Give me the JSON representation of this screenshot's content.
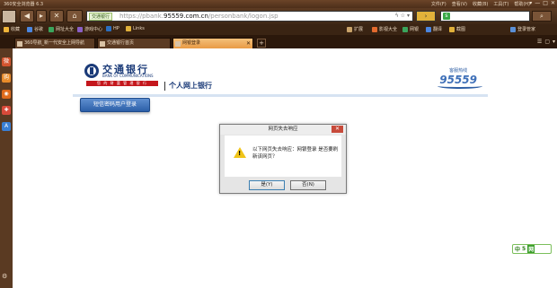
{
  "window": {
    "title": "360安全浏览器 6.3",
    "menus": [
      "文件(F)",
      "查看(V)",
      "收藏(B)",
      "工具(T)",
      "帮助(H)"
    ],
    "controls": [
      "▾",
      "—",
      "□",
      "✕"
    ]
  },
  "navbar": {
    "site_badge": "交通银行",
    "url_dim_prefix": "https://pbank.",
    "url_domain": "95559.com.cn",
    "url_dim_suffix": "/personbank/logon.jsp",
    "go_label": "›",
    "search_icon": "s",
    "search_button": "⌕"
  },
  "favorites": [
    {
      "label": "收藏",
      "color": "#f0b53a"
    },
    {
      "label": "谷歌",
      "color": "#4b86e0"
    },
    {
      "label": "网址大全",
      "color": "#3aa55c"
    },
    {
      "label": "游戏中心",
      "color": "#8a5fc5"
    },
    {
      "label": "HP",
      "color": "#2c6fbf"
    },
    {
      "label": "Links",
      "color": "#e0b03a"
    },
    {
      "label": "扩展",
      "color": "#c9a36a"
    },
    {
      "label": "影视大全",
      "color": "#e36a2e"
    },
    {
      "label": "网银",
      "color": "#3aa55c"
    },
    {
      "label": "翻译",
      "color": "#4b86e0"
    },
    {
      "label": "截图",
      "color": "#e0b03a"
    },
    {
      "label": "登录管家",
      "color": "#5a8fd6"
    }
  ],
  "tabs": [
    {
      "label": "360导航_新一代安全上网导航",
      "active": false
    },
    {
      "label": "交通银行首页",
      "active": false
    },
    {
      "label": "网银登录",
      "active": true
    }
  ],
  "tabbar_right": [
    "☰",
    "▢",
    "▾"
  ],
  "sidebar_icons": [
    {
      "name": "weibo-icon",
      "glyph": "微",
      "color": "#d4542e"
    },
    {
      "name": "shopping-icon",
      "glyph": "购",
      "color": "#e98b2a"
    },
    {
      "name": "rss-icon",
      "glyph": "◉",
      "color": "#e06a1a"
    },
    {
      "name": "app-icon",
      "glyph": "✚",
      "color": "#d94a3a"
    },
    {
      "name": "translate-icon",
      "glyph": "A",
      "color": "#3a7fd4"
    }
  ],
  "bank": {
    "name_cn": "交通银行",
    "name_en": "BANK OF COMMUNICATIONS",
    "slogan": "您 的 财 富 管 理 银 行",
    "ebank": "个人网上银行",
    "hotline_label": "客服热线",
    "hotline_number": "95559",
    "sms_button": "短信密码用户登录"
  },
  "dialog": {
    "title": "网页失去响应",
    "close": "✕",
    "message": "以下网页失去响应：网银登录 是否要刷新该网页？",
    "yes_label": "是(Y)",
    "no_label": "否(N)"
  },
  "ime": {
    "prefix": "中",
    "mid": "5",
    "suffix": "网"
  }
}
